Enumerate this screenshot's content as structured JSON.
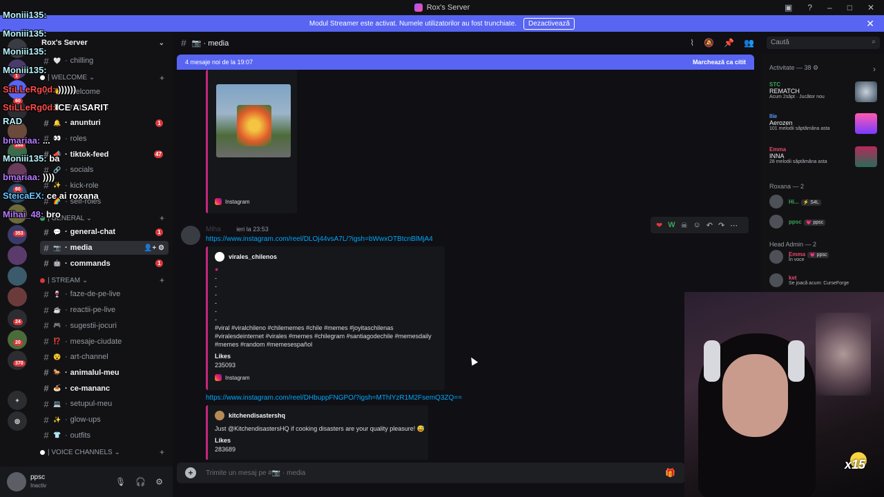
{
  "window": {
    "title": "Rox's Server"
  },
  "banner": {
    "text": "Modul Streamer este activat. Numele utilizatorilor au fost trunchiate.",
    "button": "Dezactivează"
  },
  "server": {
    "name": "Rox's Server"
  },
  "channels": [
    {
      "type": "channel",
      "emoji": "🤍",
      "name": "chilling",
      "unread": false
    },
    {
      "type": "category",
      "dot": "#ffffff",
      "name": "| WELCOME"
    },
    {
      "type": "channel",
      "emoji": "👋",
      "name": "welcome",
      "unread": false
    },
    {
      "type": "channel",
      "emoji": "📋",
      "name": "regulament",
      "unread": false
    },
    {
      "type": "channel",
      "emoji": "🔔",
      "name": "anunturi",
      "unread": true,
      "count": "1"
    },
    {
      "type": "channel",
      "emoji": "👀",
      "name": "roles",
      "unread": false
    },
    {
      "type": "channel",
      "emoji": "📣",
      "name": "tiktok-feed",
      "unread": true,
      "count": "47"
    },
    {
      "type": "channel",
      "emoji": "🔗",
      "name": "socials",
      "unread": false
    },
    {
      "type": "channel",
      "emoji": "✨",
      "name": "kick-role",
      "unread": false
    },
    {
      "type": "channel",
      "emoji": "🌈",
      "name": "self-roles",
      "unread": false
    },
    {
      "type": "category",
      "dot": "#3ba55d",
      "name": "| GENERAL"
    },
    {
      "type": "channel",
      "emoji": "💬",
      "name": "general-chat",
      "unread": true,
      "count": "1"
    },
    {
      "type": "channel",
      "emoji": "📷",
      "name": "media",
      "unread": true,
      "active": true
    },
    {
      "type": "channel",
      "emoji": "🤖",
      "name": "commands",
      "unread": true,
      "count": "1"
    },
    {
      "type": "category",
      "dot": "#da373c",
      "name": "| STREAM"
    },
    {
      "type": "channel",
      "emoji": "🍷",
      "name": "faze-de-pe-live",
      "unread": false
    },
    {
      "type": "channel",
      "emoji": "☕",
      "name": "reactii-pe-live",
      "unread": false
    },
    {
      "type": "channel",
      "emoji": "🎮",
      "name": "sugestii-jocuri",
      "unread": false
    },
    {
      "type": "channel",
      "emoji": "⁉️",
      "name": "mesaje-ciudate",
      "unread": false
    },
    {
      "type": "channel",
      "emoji": "😵",
      "name": "art-channel",
      "unread": false
    },
    {
      "type": "channel",
      "emoji": "🐎",
      "name": "animalul-meu",
      "unread": true
    },
    {
      "type": "channel",
      "emoji": "🍝",
      "name": "ce-mananc",
      "unread": true
    },
    {
      "type": "channel",
      "emoji": "💻",
      "name": "setupul-meu",
      "unread": false
    },
    {
      "type": "channel",
      "emoji": "✨",
      "name": "glow-ups",
      "unread": false
    },
    {
      "type": "channel",
      "emoji": "👕",
      "name": "outfits",
      "unread": false
    },
    {
      "type": "category",
      "dot": "#ffffff",
      "name": "| VOICE CHANNELS"
    }
  ],
  "rail_badges": [
    "1",
    "60",
    "268",
    "60",
    "353",
    "24",
    "20",
    "370"
  ],
  "user": {
    "name": "ppsc",
    "status": "Inactiv"
  },
  "header": {
    "channel": "📷 · media"
  },
  "search": {
    "placeholder": "Caută"
  },
  "newbar": {
    "text": "4 mesaje noi de la 19:07",
    "mark": "Marchează ca citit"
  },
  "messages": {
    "embed1_source": "Instagram",
    "msg2": {
      "author": "Miha",
      "time": "ieri la 23:53",
      "link": "https://www.instagram.com/reel/DLOj44vsA7L/?igsh=bWwxOTBtcnBlMjA4",
      "embed": {
        "account": "virales_chilenos",
        "dashes": [
          "-",
          "-",
          "-",
          "-",
          "-",
          "-"
        ],
        "tags1": "#viral #viralchileno #chilememes #chile #memes #joyitaschilenas",
        "tags2": "#viralesdeinternet #virales #memes #chilegram #santiagodechile #memesdaily",
        "tags3": "#memes #random #memesespañol",
        "likes_label": "Likes",
        "likes": "235093",
        "source": "Instagram"
      }
    },
    "msg3": {
      "link": "https://www.instagram.com/reel/DHbuppFNGPO/?igsh=MThlYzR1M2FsemQ3ZQ==",
      "embed": {
        "account": "kitchendisastershq",
        "text": "Just @KitchendisastersHQ if cooking disasters are your quality pleasure! 😅",
        "likes_label": "Likes",
        "likes": "283689"
      }
    },
    "reactions": [
      "❤️",
      "W",
      "💀"
    ]
  },
  "composer": {
    "placeholder": "Trimite un mesaj pe #📷 · media"
  },
  "members": {
    "activity_title": "Activitate — 38",
    "activity": [
      {
        "name": "STC",
        "color": "#3ba55d",
        "title": "REMATCH",
        "sub": "Acum 2săpt · Jucător nou"
      },
      {
        "name": "Ilie",
        "color": "#5c9cff",
        "title": "Aerozen",
        "sub": "101 melodii săptămâna asta"
      },
      {
        "name": "Emma",
        "color": "#e84a6e",
        "title": "INNA",
        "sub": "28 melodii săptămâna asta"
      }
    ],
    "roxana_title": "Roxana — 2",
    "roxana": [
      {
        "name": "Hi...",
        "tag": "⚡ S4L"
      },
      {
        "name": "ppsc",
        "tag": "💗 ppsc"
      }
    ],
    "headadmin_title": "Head Admin — 2",
    "headadmin": [
      {
        "name": "Emma",
        "tag": "💗 ppsc",
        "sub": "În voce"
      },
      {
        "name": "ket",
        "tag": "",
        "sub": "Se joacă acum: CurseForge"
      }
    ]
  },
  "overlay_chat": [
    {
      "user": "Moniii135:",
      "text": "",
      "cls": ""
    },
    {
      "user": "Moniii135:",
      "text": "",
      "cls": ""
    },
    {
      "user": "Moniii135:",
      "text": "",
      "cls": ""
    },
    {
      "user": "Moniii135:",
      "text": "",
      "cls": ""
    },
    {
      "user": "StiLLeRg0d:",
      "text": "))))))",
      "cls": "red"
    },
    {
      "user": "StiLLeRg0d:",
      "text": "CE A SARIT",
      "cls": "red"
    },
    {
      "user": "RAD",
      "text": "",
      "cls": ""
    },
    {
      "user": "bmariaa:",
      "text": "...",
      "cls": "pur"
    },
    {
      "user": "Moniii135:",
      "text": "ba",
      "cls": ""
    },
    {
      "user": "bmariaa:",
      "text": "))))",
      "cls": "pur"
    },
    {
      "user": "SteicaEX:",
      "text": "ce ai roxana",
      "cls": "blu"
    },
    {
      "user": "Mihai_48:",
      "text": "bro",
      "cls": "pur"
    }
  ],
  "cam": {
    "counter": "x15"
  }
}
